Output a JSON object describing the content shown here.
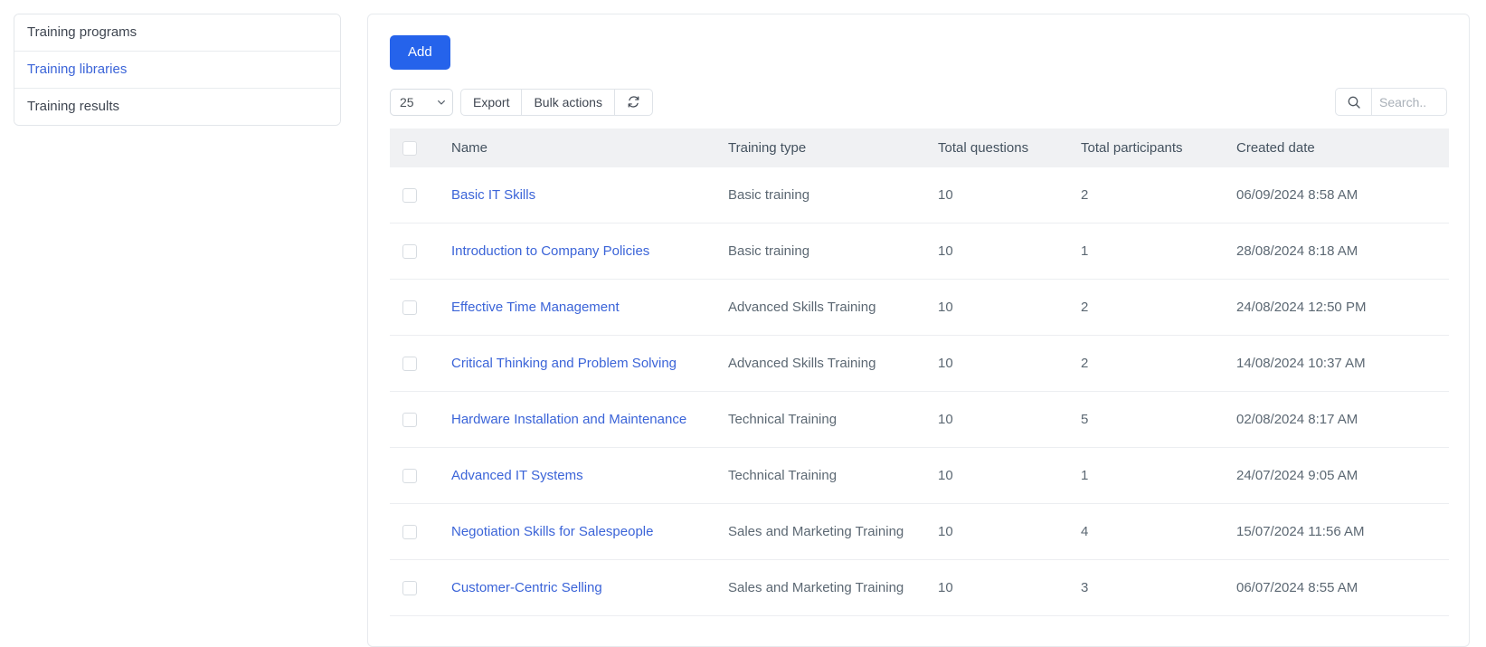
{
  "sidebar": {
    "items": [
      {
        "label": "Training programs",
        "active": false
      },
      {
        "label": "Training libraries",
        "active": true
      },
      {
        "label": "Training results",
        "active": false
      }
    ]
  },
  "toolbar": {
    "add_label": "Add",
    "page_size_value": "25",
    "page_size_options": [
      "25"
    ],
    "export_label": "Export",
    "bulk_actions_label": "Bulk actions",
    "refresh_icon": "refresh-icon",
    "search_icon": "search-icon",
    "search_value": "",
    "search_placeholder": "Search.."
  },
  "table": {
    "columns": [
      {
        "key": "check",
        "label": ""
      },
      {
        "key": "name",
        "label": "Name"
      },
      {
        "key": "type",
        "label": "Training type"
      },
      {
        "key": "questions",
        "label": "Total questions"
      },
      {
        "key": "participants",
        "label": "Total participants"
      },
      {
        "key": "created",
        "label": "Created date"
      }
    ],
    "rows": [
      {
        "name": "Basic IT Skills",
        "type": "Basic training",
        "questions": "10",
        "participants": "2",
        "created": "06/09/2024 8:58 AM"
      },
      {
        "name": "Introduction to Company Policies",
        "type": "Basic training",
        "questions": "10",
        "participants": "1",
        "created": "28/08/2024 8:18 AM"
      },
      {
        "name": "Effective Time Management",
        "type": "Advanced Skills Training",
        "questions": "10",
        "participants": "2",
        "created": "24/08/2024 12:50 PM"
      },
      {
        "name": "Critical Thinking and Problem Solving",
        "type": "Advanced Skills Training",
        "questions": "10",
        "participants": "2",
        "created": "14/08/2024 10:37 AM"
      },
      {
        "name": "Hardware Installation and Maintenance",
        "type": "Technical Training",
        "questions": "10",
        "participants": "5",
        "created": "02/08/2024 8:17 AM"
      },
      {
        "name": "Advanced IT Systems",
        "type": "Technical Training",
        "questions": "10",
        "participants": "1",
        "created": "24/07/2024 9:05 AM"
      },
      {
        "name": "Negotiation Skills for Salespeople",
        "type": "Sales and Marketing Training",
        "questions": "10",
        "participants": "4",
        "created": "15/07/2024 11:56 AM"
      },
      {
        "name": "Customer-Centric Selling",
        "type": "Sales and Marketing Training",
        "questions": "10",
        "participants": "3",
        "created": "06/07/2024 8:55 AM"
      }
    ]
  },
  "colors": {
    "primary": "#2563eb",
    "link": "#3b64d8",
    "header_bg": "#f0f1f3",
    "border": "#e7eaee"
  }
}
